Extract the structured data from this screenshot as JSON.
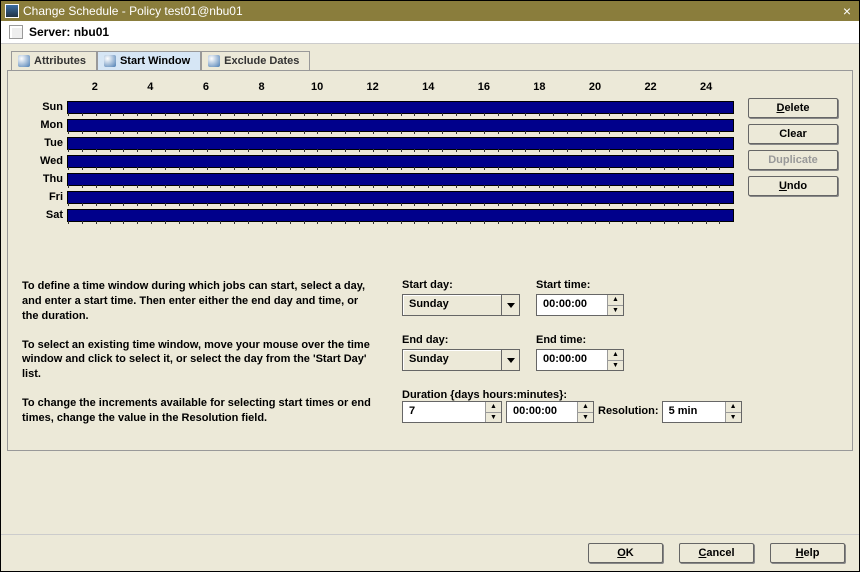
{
  "window": {
    "title": "Change Schedule - Policy test01@nbu01"
  },
  "server": {
    "label": "Server:",
    "value": "nbu01"
  },
  "tabs": {
    "attributes": "Attributes",
    "start_window": "Start Window",
    "exclude_dates": "Exclude Dates",
    "active": "start_window"
  },
  "hours": [
    "2",
    "4",
    "6",
    "8",
    "10",
    "12",
    "14",
    "16",
    "18",
    "20",
    "22",
    "24"
  ],
  "days": [
    "Sun",
    "Mon",
    "Tue",
    "Wed",
    "Thu",
    "Fri",
    "Sat"
  ],
  "buttons": {
    "delete": "Delete",
    "clear": "Clear",
    "duplicate": "Duplicate",
    "undo": "Undo"
  },
  "instructions": {
    "p1": "To define a time window during which jobs can start, select a day, and enter a start time. Then enter either the end day and time, or the duration.",
    "p2": "To select an existing time window, move your mouse over the time window and click to select it, or select the day from the 'Start Day' list.",
    "p3": "To change the increments available for selecting start times or end times, change the value in the Resolution field."
  },
  "form": {
    "start_day_label": "Start day:",
    "start_day_value": "Sunday",
    "start_time_label": "Start time:",
    "start_time_value": "00:00:00",
    "end_day_label": "End day:",
    "end_day_value": "Sunday",
    "end_time_label": "End time:",
    "end_time_value": "00:00:00",
    "duration_label": "Duration {days hours:minutes}:",
    "duration_days": "7",
    "duration_time": "00:00:00",
    "resolution_label": "Resolution:",
    "resolution_value": "5 min"
  },
  "footer": {
    "ok": "OK",
    "cancel": "Cancel",
    "help": "Help"
  }
}
